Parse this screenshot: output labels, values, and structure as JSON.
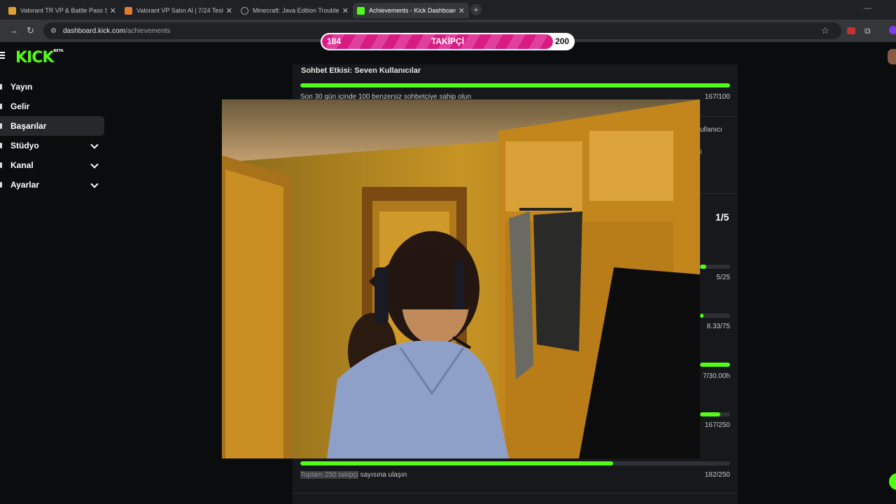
{
  "browser": {
    "tabs": [
      {
        "title": "Valorant TR VP & Battle Pass Sa",
        "favicon_color": "#e0a030",
        "active": false
      },
      {
        "title": "Valorant VP Satın Al | 7/24 Tesl",
        "favicon_color": "#e07a30",
        "active": false
      },
      {
        "title": "Minecraft: Java Edition Trouble",
        "favicon_color": "#9aa0a6",
        "active": false
      },
      {
        "title": "Achievements - Kick Dashboard",
        "favicon_color": "#53fc18",
        "active": true
      }
    ],
    "address": {
      "host": "dashboard.kick.com",
      "path": "/achievements"
    }
  },
  "goal_overlay": {
    "current": "184",
    "label": "TAKİPÇİ",
    "target": "200",
    "progress": 0.92
  },
  "header": {
    "logo_text": "KICK",
    "logo_badge": "BETA"
  },
  "sidebar": {
    "items": [
      {
        "label": "Yayın",
        "active": false,
        "expandable": false
      },
      {
        "label": "Gelir",
        "active": false,
        "expandable": false
      },
      {
        "label": "Başarılar",
        "active": true,
        "expandable": false
      },
      {
        "label": "Stüdyo",
        "active": false,
        "expandable": true
      },
      {
        "label": "Kanal",
        "active": false,
        "expandable": true
      },
      {
        "label": "Ayarlar",
        "active": false,
        "expandable": true
      }
    ]
  },
  "achievements": {
    "top_title": "Sohbet Etkisi: Seven Kullanıcılar",
    "top_desc": "Son 30 gün içinde 100 benzersiz sohbetçiye sahip olun",
    "top_value": "167/100",
    "top_progress": 1.0,
    "partial_right_1": "ullanıcı",
    "partial_right_2": "i",
    "section_count": "1/5",
    "rows": [
      {
        "value": "5/25",
        "progress": 0.2
      },
      {
        "value": "8.33/75",
        "progress": 0.11
      },
      {
        "value": "7/30.00h",
        "progress": 1.0
      },
      {
        "value": "167/250",
        "progress": 0.67
      }
    ],
    "bottom": {
      "desc_highlight": "Toplam 250 takipçi",
      "desc_rest": " sayısına ulaşın",
      "value": "182/250",
      "progress": 0.728
    }
  }
}
